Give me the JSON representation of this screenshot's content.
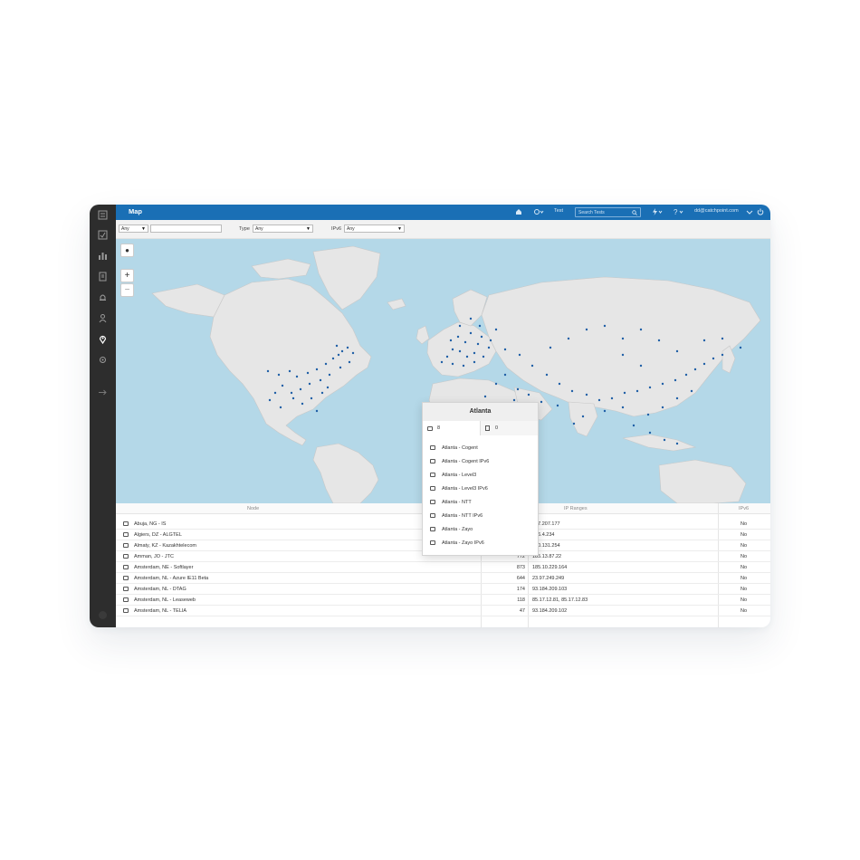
{
  "header": {
    "title": "Map",
    "test_link": "Test",
    "search_placeholder": "Search Tests",
    "user": "dd@catchpoint.com"
  },
  "filters": {
    "first_select": "Any",
    "type_label": "Type",
    "type_value": "Any",
    "ipv6_label": "IPv6",
    "ipv6_value": "Any"
  },
  "map_controls": {
    "zoom_in": "+",
    "zoom_out": "−"
  },
  "popup": {
    "title": "Atlanta",
    "tab_nodes_count": "8",
    "tab_other_count": "0",
    "items": [
      "Atlanta - Cogent",
      "Atlanta - Cogent IPv6",
      "Atlanta - Level3",
      "Atlanta - Level3 IPv6",
      "Atlanta - NTT",
      "Atlanta - NTT IPv6",
      "Atlanta - Zayo",
      "Atlanta - Zayo IPv6"
    ]
  },
  "table": {
    "columns": [
      "Node",
      "IP Ranges",
      "IPv6"
    ],
    "rows": [
      {
        "node": "Abuja, NG - IS",
        "count": "",
        "ip": "217.207.177",
        "ipv6": "No"
      },
      {
        "node": "Algiers, DZ - ALGTEL",
        "count": "",
        "ip": "106.4.234",
        "ipv6": "No"
      },
      {
        "node": "Almaty, KZ - Kazakhtelecom",
        "count": "",
        "ip": "200.131.254",
        "ipv6": "No"
      },
      {
        "node": "Amman, JO - JTC",
        "count": "772",
        "ip": "185.13.87.22",
        "ipv6": "No"
      },
      {
        "node": "Amsterdam, NE - Softlayer",
        "count": "873",
        "ip": "185.10.229.164",
        "ipv6": "No"
      },
      {
        "node": "Amsterdam, NL - Azure IE11 Beta",
        "count": "644",
        "ip": "23.97.249.249",
        "ipv6": "No"
      },
      {
        "node": "Amsterdam, NL - DTAG",
        "count": "174",
        "ip": "93.184.209.103",
        "ipv6": "No"
      },
      {
        "node": "Amsterdam, NL - Leaseweb",
        "count": "118",
        "ip": "85.17.12.81, 85.17.12.83",
        "ipv6": "No"
      },
      {
        "node": "Amsterdam, NL - TELIA",
        "count": "47",
        "ip": "93.184.209.102",
        "ipv6": "No"
      }
    ]
  },
  "colors": {
    "brand_blue": "#1a6fb5",
    "sidebar": "#2d2d2d",
    "ocean": "#b4d8e8",
    "land": "#e6e6e6",
    "node_dot": "#1f5fa6"
  },
  "icons": {
    "sidebar": [
      "dashboard-icon",
      "tests-icon",
      "chart-icon",
      "report-icon",
      "alert-icon",
      "user-icon",
      "location-icon",
      "settings-icon",
      "logout-icon"
    ],
    "header": [
      "home-icon",
      "tests-dropdown-icon",
      "search-icon",
      "bolt-icon",
      "help-icon",
      "power-icon"
    ]
  }
}
